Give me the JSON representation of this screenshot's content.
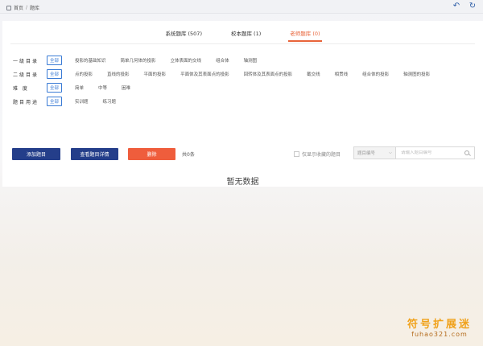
{
  "breadcrumb": {
    "home": "首页",
    "separator": "/",
    "current": "题库"
  },
  "tabs": [
    {
      "label": "系统题库 (507)",
      "active": false
    },
    {
      "label": "校本题库 (1)",
      "active": false
    },
    {
      "label": "老师题库 (0)",
      "active": true
    }
  ],
  "filters": [
    {
      "label": "一级目录",
      "options": [
        "全部",
        "投影的基础知识",
        "简单几何体的投影",
        "立体表面的交线",
        "组合体",
        "轴测图"
      ],
      "selected": 0
    },
    {
      "label": "二级目录",
      "options": [
        "全部",
        "点的投影",
        "直线的投影",
        "平面的投影",
        "平面体及其表面点的投影",
        "回转体及其表面点的投影",
        "截交线",
        "相贯线",
        "组合体的投影",
        "轴测图的投影"
      ],
      "selected": 0
    },
    {
      "label": "难 度",
      "options": [
        "全部",
        "简单",
        "中等",
        "困难"
      ],
      "selected": 0
    },
    {
      "label": "题目用途",
      "options": [
        "全部",
        "实训题",
        "练习题"
      ],
      "selected": 0
    }
  ],
  "actions": {
    "add": "添加题目",
    "view_detail": "查看题目详情",
    "delete": "删除",
    "total": "共0条"
  },
  "search": {
    "only_mine_label": "仅显示收藏的题目",
    "select_value": "题目编号",
    "placeholder": "请输入题目编号"
  },
  "empty_text": "暂无数据",
  "watermark": {
    "line1": "符号扩展迷",
    "line2": "fuhao321.com"
  },
  "colors": {
    "accent": "#e8643a",
    "primary": "#243e8a",
    "danger": "#ef5d3c",
    "link": "#3a7bd5"
  }
}
